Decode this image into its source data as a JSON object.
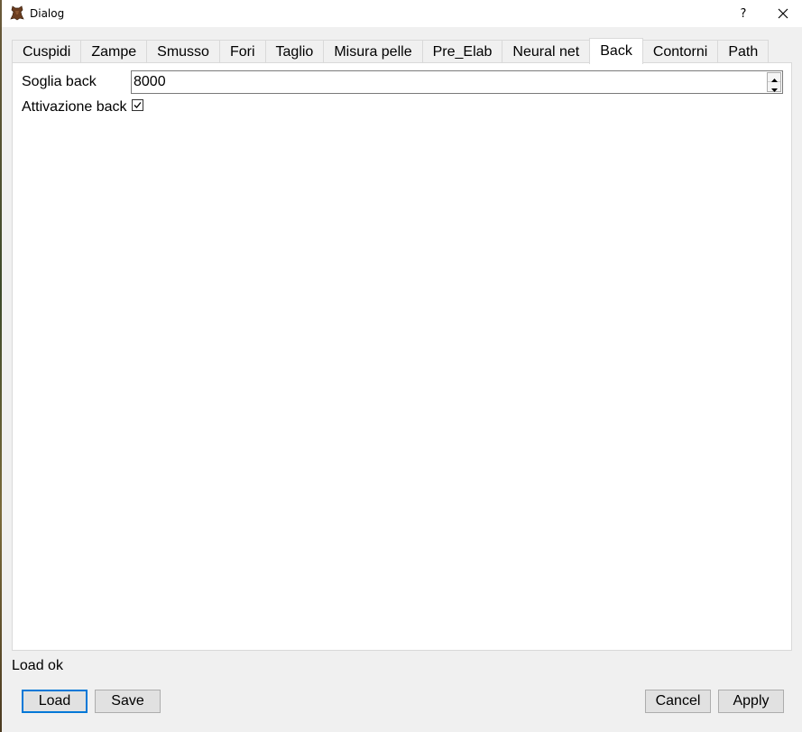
{
  "window": {
    "title": "Dialog",
    "help_label": "?"
  },
  "tabs": [
    {
      "label": "Cuspidi"
    },
    {
      "label": "Zampe"
    },
    {
      "label": "Smusso"
    },
    {
      "label": "Fori"
    },
    {
      "label": "Taglio"
    },
    {
      "label": "Misura pelle"
    },
    {
      "label": "Pre_Elab"
    },
    {
      "label": "Neural net"
    },
    {
      "label": "Back",
      "active": true
    },
    {
      "label": "Contorni"
    },
    {
      "label": "Path"
    }
  ],
  "back_tab": {
    "soglia_label": "Soglia back",
    "soglia_value": "8000",
    "attivazione_label": "Attivazione back",
    "attivazione_checked": true
  },
  "status_text": "Load ok",
  "buttons": {
    "load": "Load",
    "save": "Save",
    "cancel": "Cancel",
    "apply": "Apply"
  },
  "colors": {
    "accent": "#0078d7",
    "panel_bg": "#ffffff",
    "window_bg": "#f0f0f0"
  }
}
